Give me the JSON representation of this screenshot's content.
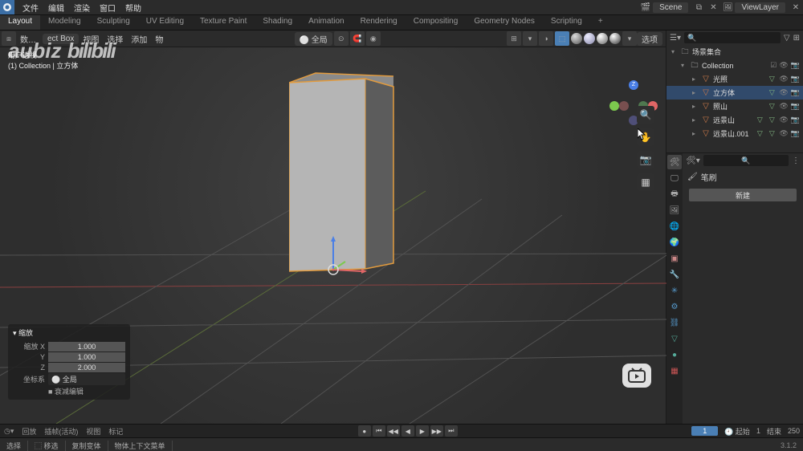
{
  "top_menu": {
    "items": [
      "文件",
      "编辑",
      "渲染",
      "窗口",
      "帮助"
    ],
    "scene_label": "Scene",
    "viewlayer_label": "ViewLayer"
  },
  "tabs": {
    "items": [
      "Layout",
      "Modeling",
      "Sculpting",
      "UV Editing",
      "Texture Paint",
      "Shading",
      "Animation",
      "Rendering",
      "Compositing",
      "Geometry Nodes",
      "Scripting",
      "+"
    ],
    "active": 0
  },
  "vp_header": {
    "mode": "⧈",
    "interact": "ect Box",
    "view": "视图",
    "select": "选择",
    "add": "添加",
    "object": "物",
    "dd": "⚪ 全局",
    "opts": "选项"
  },
  "info": {
    "l1": "用户透视",
    "l2": "(1) Collection | 立方体"
  },
  "watermark": "aubiz",
  "watermark_b": "bilibili",
  "gizmo": {
    "z": "Z"
  },
  "nav_tools": [
    "🔍",
    "✋",
    "📷",
    "▦"
  ],
  "op_panel": {
    "title": "缩放",
    "rows": [
      {
        "lbl": "缩放 X",
        "val": "1.000"
      },
      {
        "lbl": "Y",
        "val": "1.000"
      },
      {
        "lbl": "Z",
        "val": "2.000"
      }
    ],
    "orient_lbl": "坐标系",
    "orient_val": "⚪ 全局",
    "check": "■ 衰减编辑"
  },
  "timeline": {
    "play": "回放",
    "keying": "插帧(活动) ",
    "view": "视图",
    "marker": "标记",
    "frame": "1",
    "start_lbl": "起始",
    "start": "1",
    "end_lbl": "结束",
    "end": "250"
  },
  "status": {
    "items": [
      "选择",
      "⬚ 移选",
      "复制变体",
      "物体上下文菜单"
    ],
    "version": "3.1.2"
  },
  "outliner": {
    "root": "场景集合",
    "coll": "Collection",
    "items": [
      {
        "name": "光照",
        "ic": "▽"
      },
      {
        "name": "立方体",
        "ic": "▽",
        "active": true
      },
      {
        "name": "照山",
        "ic": "▽"
      },
      {
        "name": "远景山",
        "ic": "▽"
      },
      {
        "name": "远景山.001",
        "ic": "▽"
      }
    ],
    "search_ph": "🔍"
  },
  "props": {
    "breadcrumb": "笔刷",
    "new_label": "新建",
    "search_ph": "🔍"
  },
  "vtab_colors": [
    "#888",
    "#888",
    "#888",
    "#888",
    "#888",
    "#888",
    "#c88",
    "#888",
    "#5a9",
    "#59c",
    "#59c",
    "#59c",
    "#59c",
    "#59c",
    "#5a9",
    "#5a9",
    "#c88",
    "#c55"
  ]
}
